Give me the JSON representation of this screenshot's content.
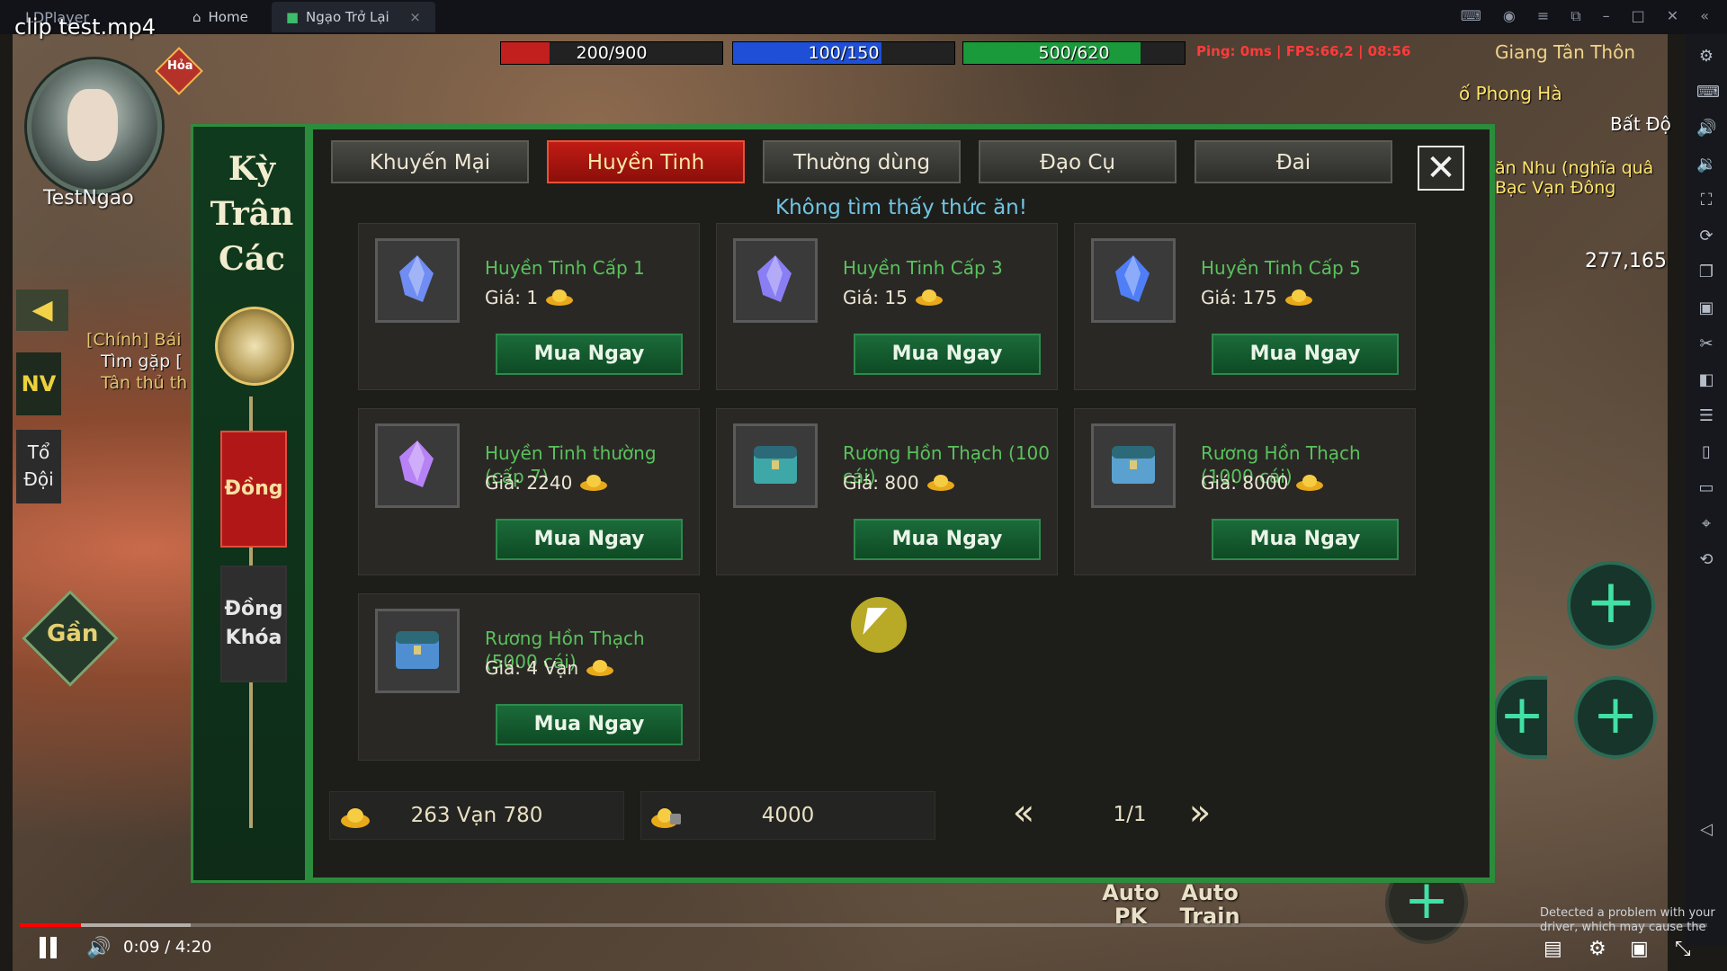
{
  "emulator": {
    "brand": "LDPlayer",
    "tabs": [
      {
        "label": "Home"
      },
      {
        "label": "Ngạo Trở Lại"
      }
    ]
  },
  "video": {
    "title": "clip test.mp4",
    "time": "0:09 / 4:20",
    "progress_fraction": 0.036,
    "warning": "Detected a problem with your driver, which may cause the"
  },
  "hud": {
    "hp": {
      "text": "200/900",
      "fraction": 0.22,
      "color": "#c21f1f"
    },
    "mp": {
      "text": "100/150",
      "fraction": 0.67,
      "color": "#1e4fd6"
    },
    "sp": {
      "text": "500/620",
      "fraction": 0.8,
      "color": "#1a9a3a"
    },
    "status": "Ping: 0ms | FPS:66,2 | 08:56",
    "location": "Giang Tân Thôn",
    "map_labels": [
      "ố Phong Hà",
      "Bất Độ",
      "ăn Nhu (nghĩa quâ Bạc Vạn Đông"
    ],
    "coins": "277,165",
    "player_name": "TestNgao",
    "hoa": "Hỏa",
    "quest_lines": [
      "[Chính] Bái",
      "Tìm gặp [",
      "Tân thủ th"
    ],
    "nv": "NV",
    "to_doi": "Tổ Đội",
    "gan": "Gần",
    "auto_pk": "Auto PK",
    "auto_train": "Auto Train"
  },
  "shop": {
    "title": "Kỳ Trân Các",
    "currency_tabs": [
      {
        "label": "Đồng",
        "active": true
      },
      {
        "label": "Đồng Khóa",
        "active": false
      }
    ],
    "tabs": [
      {
        "label": "Khuyến Mại",
        "active": false
      },
      {
        "label": "Huyền Tinh",
        "active": true
      },
      {
        "label": "Thường dùng",
        "active": false
      },
      {
        "label": "Đạo Cụ",
        "active": false
      },
      {
        "label": "Đai",
        "active": false
      }
    ],
    "close_label": "✕",
    "notice": "Không tìm thấy thức ăn!",
    "price_label": "Giá:",
    "buy_label": "Mua Ngay",
    "items": [
      {
        "name": "Huyền Tinh Cấp 1",
        "price": "1",
        "icon": "crystal-icon",
        "color": "#6f8df2"
      },
      {
        "name": "Huyền Tinh Cấp 3",
        "price": "15",
        "icon": "crystal-cluster-icon",
        "color": "#8a7ef4"
      },
      {
        "name": "Huyền Tinh Cấp 5",
        "price": "175",
        "icon": "crystal-shards-icon",
        "color": "#4f7ef7"
      },
      {
        "name": "Huyền Tinh thường (cấp 7)",
        "price": "2240",
        "icon": "crystal-purple-icon",
        "color": "#b782f5"
      },
      {
        "name": "Rương Hồn Thạch (100 cái)",
        "price": "800",
        "icon": "chest-icon",
        "color": "#3ea8a8"
      },
      {
        "name": "Rương Hồn Thạch (1000 cái)",
        "price": "8000",
        "icon": "chest-icon",
        "color": "#5aa1d0"
      },
      {
        "name": "Rương Hồn Thạch (5000 cái)",
        "price": "4 Vạn",
        "icon": "chest-icon",
        "color": "#4f8fd1"
      }
    ],
    "footer": {
      "dong": "263 Vạn 780",
      "dong_khoa": "4000",
      "page": "1/1",
      "prev": "«",
      "next": "»"
    }
  }
}
